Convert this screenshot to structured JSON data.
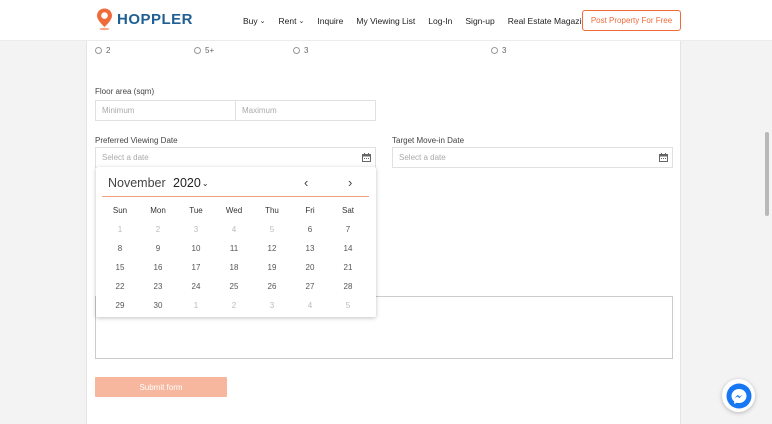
{
  "header": {
    "logo_text": "HOPPLER",
    "nav": [
      {
        "label": "Buy",
        "caret": "⌄"
      },
      {
        "label": "Rent",
        "caret": "⌄"
      },
      {
        "label": "Inquire"
      },
      {
        "label": "My Viewing List"
      },
      {
        "label": "Log-In"
      },
      {
        "label": "Sign-up"
      },
      {
        "label": "Real Estate Magazine"
      }
    ],
    "post_button": "Post Property For Free"
  },
  "radios": [
    "2",
    "5+",
    "3",
    "3"
  ],
  "floor_area": {
    "label": "Floor area (sqm)",
    "min_placeholder": "Minimum",
    "max_placeholder": "Maximum"
  },
  "viewing_date": {
    "label": "Preferred Viewing Date",
    "placeholder": "Select a date"
  },
  "move_in_date": {
    "label": "Target Move-in Date",
    "placeholder": "Select a date"
  },
  "calendar": {
    "month": "November",
    "year": "2020",
    "prev": "‹",
    "next": "›",
    "weekdays": [
      "Sun",
      "Mon",
      "Tue",
      "Wed",
      "Thu",
      "Fri",
      "Sat"
    ],
    "weeks": [
      [
        {
          "d": "1",
          "m": true
        },
        {
          "d": "2",
          "m": true
        },
        {
          "d": "3",
          "m": true
        },
        {
          "d": "4",
          "m": true
        },
        {
          "d": "5",
          "m": true
        },
        {
          "d": "6"
        },
        {
          "d": "7"
        }
      ],
      [
        {
          "d": "8"
        },
        {
          "d": "9"
        },
        {
          "d": "10"
        },
        {
          "d": "11"
        },
        {
          "d": "12"
        },
        {
          "d": "13"
        },
        {
          "d": "14"
        }
      ],
      [
        {
          "d": "15"
        },
        {
          "d": "16"
        },
        {
          "d": "17"
        },
        {
          "d": "18"
        },
        {
          "d": "19"
        },
        {
          "d": "20"
        },
        {
          "d": "21"
        }
      ],
      [
        {
          "d": "22"
        },
        {
          "d": "23"
        },
        {
          "d": "24"
        },
        {
          "d": "25"
        },
        {
          "d": "26"
        },
        {
          "d": "27"
        },
        {
          "d": "28"
        }
      ],
      [
        {
          "d": "29"
        },
        {
          "d": "30"
        },
        {
          "d": "1",
          "m": true
        },
        {
          "d": "2",
          "m": true
        },
        {
          "d": "3",
          "m": true
        },
        {
          "d": "4",
          "m": true
        },
        {
          "d": "5",
          "m": true
        }
      ]
    ]
  },
  "submit_label": "Submit form",
  "colors": {
    "brand_blue": "#1f5f93",
    "accent_orange": "#ef6c3a",
    "submit_bg": "#f7b79e",
    "messenger_blue": "#1877f2"
  },
  "icons": {
    "calendar": "calendar-icon",
    "messenger": "messenger-icon",
    "logo": "location-pin-icon"
  }
}
